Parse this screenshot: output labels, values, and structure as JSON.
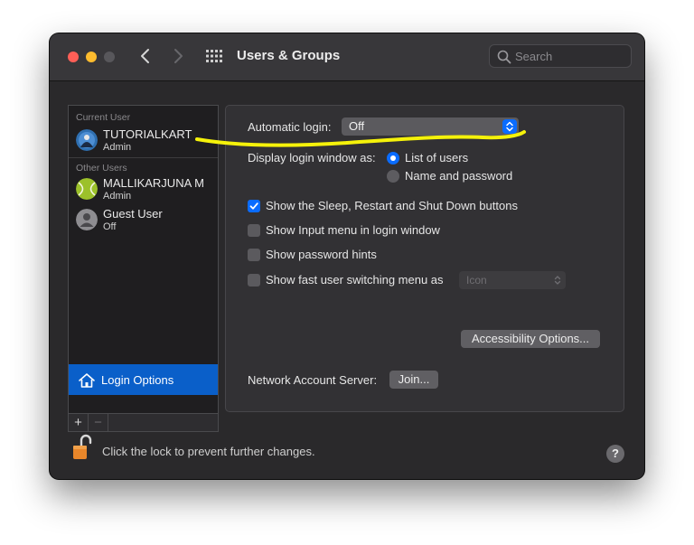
{
  "window": {
    "title": "Users & Groups",
    "search_placeholder": "Search"
  },
  "sidebar": {
    "current_user_label": "Current User",
    "current_user": {
      "name": "TUTORIALKART",
      "role": "Admin"
    },
    "other_users_label": "Other Users",
    "other_users": [
      {
        "name": "MALLIKARJUNA M",
        "role": "Admin"
      },
      {
        "name": "Guest User",
        "role": "Off"
      }
    ],
    "login_options_label": "Login Options",
    "add_label": "+",
    "remove_label": "−"
  },
  "main": {
    "automatic_login_label": "Automatic login:",
    "automatic_login_value": "Off",
    "display_login_label": "Display login window as:",
    "display_options": [
      "List of users",
      "Name and password"
    ],
    "checkboxes": [
      {
        "label": "Show the Sleep, Restart and Shut Down buttons",
        "checked": true
      },
      {
        "label": "Show Input menu in login window",
        "checked": false
      },
      {
        "label": "Show password hints",
        "checked": false
      },
      {
        "label": "Show fast user switching menu as",
        "checked": false
      }
    ],
    "fast_switch_value": "Icon",
    "accessibility_button": "Accessibility Options...",
    "network_label": "Network Account Server:",
    "join_button": "Join..."
  },
  "footer": {
    "lock_text": "Click the lock to prevent further changes.",
    "help_label": "?"
  },
  "colors": {
    "accent": "#0a6cff",
    "selection": "#0a5fc9",
    "highlight_marker": "#f5f20a"
  }
}
